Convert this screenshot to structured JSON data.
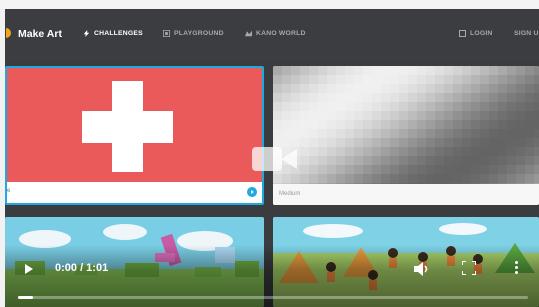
{
  "header": {
    "brand": "Make Art",
    "nav": [
      {
        "label": "CHALLENGES",
        "icon": "bolt-icon"
      },
      {
        "label": "PLAYGROUND",
        "icon": "playground-icon"
      },
      {
        "label": "KANO WORLD",
        "icon": "kano-world-icon"
      }
    ],
    "login": "LOGIN",
    "signup": "SIGN U"
  },
  "cards": [
    {
      "label": "e",
      "subject": "Swiss flag"
    },
    {
      "label": "Medium",
      "subject": "grayscale pixel gradient"
    },
    {
      "label": "",
      "subject": "block landscape"
    },
    {
      "label": "",
      "subject": "campsite with characters"
    }
  ],
  "video": {
    "time": "0:00 / 1:01",
    "progress": 0.03
  },
  "colors": {
    "topbar": "#3b3d41",
    "flag_red": "#ea5a5a",
    "accent": "#1fa9e1",
    "brand_dot": "#f6a21d"
  }
}
